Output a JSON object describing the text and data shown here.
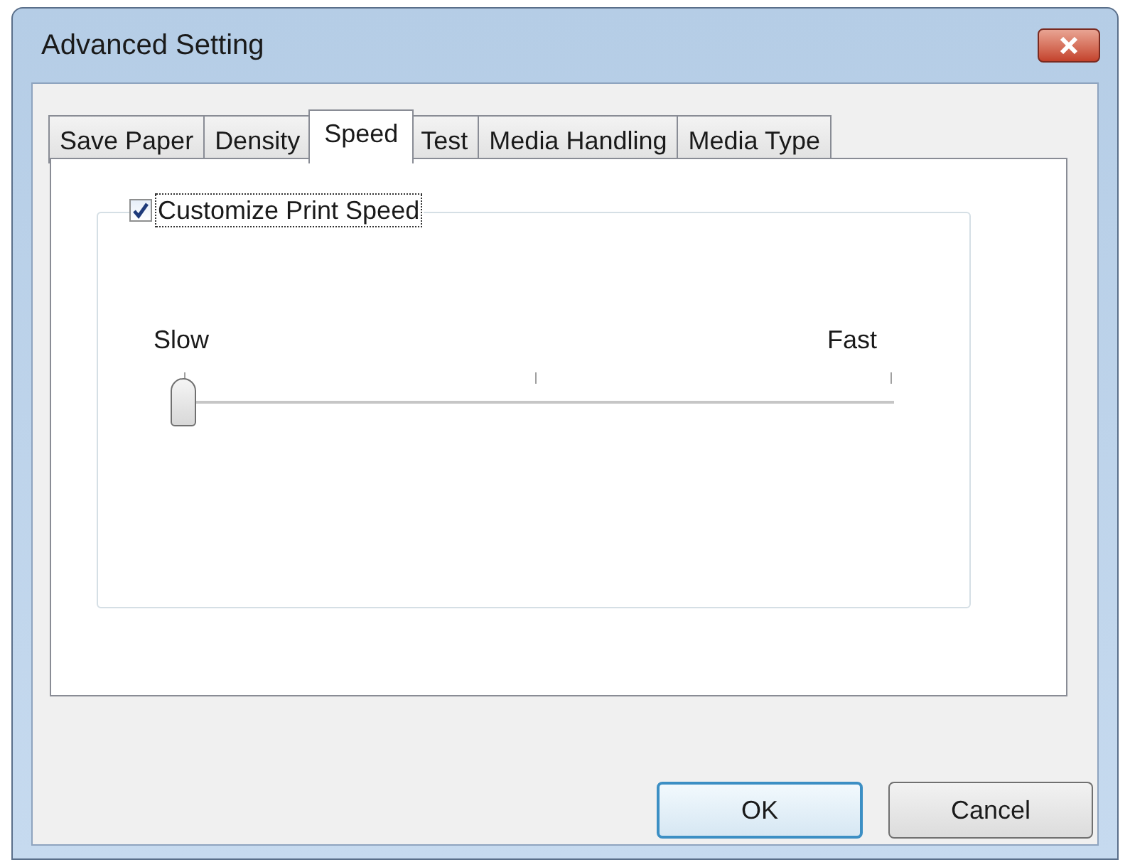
{
  "window": {
    "title": "Advanced Setting"
  },
  "tabs": [
    {
      "label": "Save Paper",
      "selected": false
    },
    {
      "label": "Density",
      "selected": false
    },
    {
      "label": "Speed",
      "selected": true
    },
    {
      "label": "Test",
      "selected": false
    },
    {
      "label": "Media Handling",
      "selected": false
    },
    {
      "label": "Media Type",
      "selected": false
    }
  ],
  "customize": {
    "label": "Customize Print Speed",
    "checked": true
  },
  "slider": {
    "min_label": "Slow",
    "max_label": "Fast",
    "level": 0
  },
  "buttons": [
    {
      "label": "OK",
      "default": true
    },
    {
      "label": "Cancel",
      "default": false
    }
  ]
}
